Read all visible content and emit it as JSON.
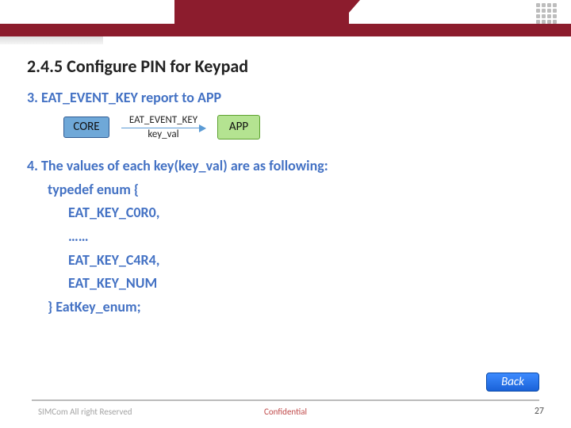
{
  "section_title": "2.4.5 Configure PIN for Keypad",
  "step3": {
    "heading": "3. EAT_EVENT_KEY report to APP",
    "core_label": "CORE",
    "app_label": "APP",
    "arrow_top": "EAT_EVENT_KEY",
    "arrow_bottom": "key_val"
  },
  "step4": {
    "heading": "4. The values of each key(key_val) are as following:",
    "l1": "typedef enum {",
    "l2": "EAT_KEY_C0R0,",
    "l3": "……",
    "l4": "EAT_KEY_C4R4,",
    "l5": "EAT_KEY_NUM",
    "l6": "} EatKey_enum;"
  },
  "back_button": "Back",
  "footer": {
    "left": "SIMCom All right Reserved",
    "center": "Confidential",
    "page": "27"
  }
}
